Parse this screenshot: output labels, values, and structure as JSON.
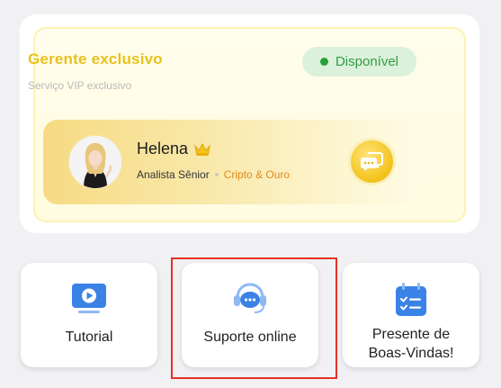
{
  "vip": {
    "title": "Gerente exclusivo",
    "subtitle": "Serviço VIP exclusivo",
    "status": "Disponível"
  },
  "manager": {
    "name": "Helena",
    "role": "Analista Sênior",
    "specialty": "Cripto & Ouro"
  },
  "tiles": [
    {
      "label": "Tutorial",
      "icon": "video-icon"
    },
    {
      "label": "Suporte online",
      "icon": "headset-icon"
    },
    {
      "label_line1": "Presente de",
      "label_line2": "Boas-Vindas!",
      "icon": "calendar-checklist-icon"
    }
  ],
  "colors": {
    "accent_yellow": "#e8c21c",
    "status_green": "#2f9c43",
    "specialty_orange": "#e08a1c",
    "icon_blue": "#3b82e6",
    "highlight_red": "#e53228"
  }
}
